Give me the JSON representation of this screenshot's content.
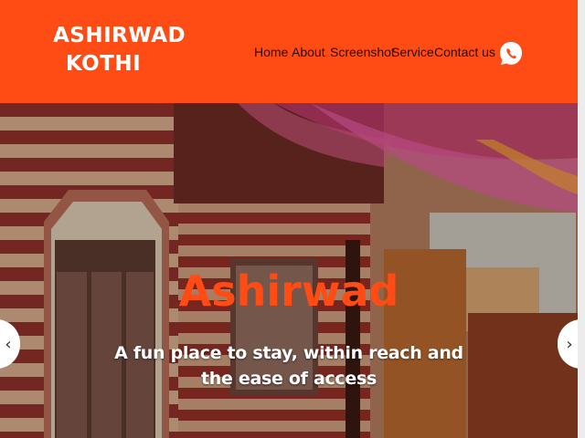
{
  "brand": {
    "line1": "ASHIRWAD",
    "line2": "KOTHI"
  },
  "nav": {
    "items": [
      {
        "label": "Home",
        "active": true
      },
      {
        "label": "About"
      },
      {
        "label": "Screenshot"
      },
      {
        "label": "Service"
      },
      {
        "label": "Contact us"
      }
    ],
    "whatsapp_icon": "whatsapp-icon"
  },
  "hero": {
    "title": "Ashirwad",
    "subtitle": "A fun place to stay, within reach and the ease of access",
    "prev_arrow": "‹",
    "next_arrow": "›"
  },
  "colors": {
    "brand_orange": "#ff4b14",
    "nav_text": "#2a0d02",
    "white": "#ffffff"
  }
}
